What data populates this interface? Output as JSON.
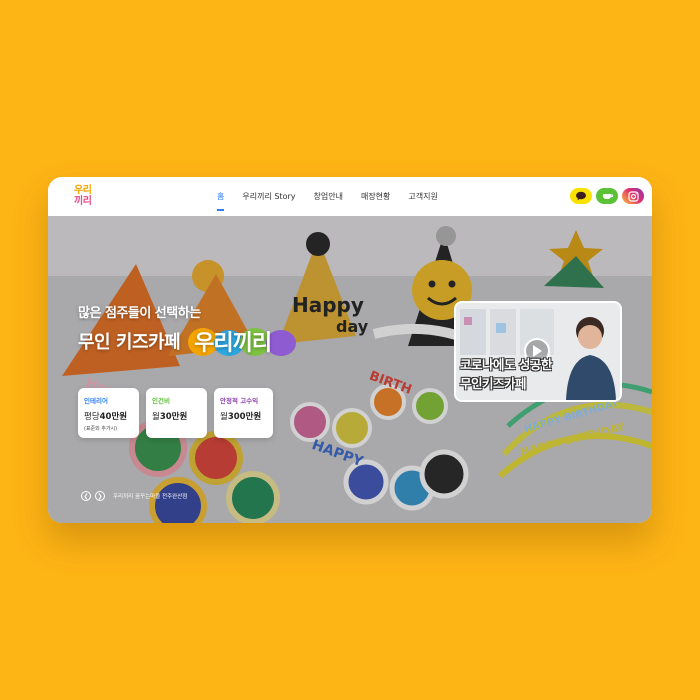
{
  "logo": {
    "line1": "우리",
    "line2": "끼리"
  },
  "nav": {
    "items": [
      {
        "label": "홈",
        "active": true
      },
      {
        "label": "우리끼리 Story",
        "active": false
      },
      {
        "label": "창업안내",
        "active": false
      },
      {
        "label": "매장현황",
        "active": false
      },
      {
        "label": "고객지원",
        "active": false
      }
    ]
  },
  "social": [
    {
      "icon": "kakao-talk-icon",
      "color": "#FAE100"
    },
    {
      "icon": "naver-blog-icon",
      "color": "#5BC236"
    },
    {
      "icon": "instagram-icon",
      "color": "#E1306C"
    }
  ],
  "hero": {
    "tagline": "많은 점주들이 선택하는",
    "headline": "무인 키즈카페",
    "brand": "우리끼리",
    "cards": [
      {
        "label": "인테리어",
        "label_color": "#2d7ff9",
        "prefix": "평당",
        "value": "40만원",
        "note": "(표준외 추가시)"
      },
      {
        "label": "인건비",
        "label_color": "#5BC236",
        "prefix": "월",
        "value": "30만원",
        "note": ""
      },
      {
        "label": "안정적 고수익",
        "label_color": "#8e44ad",
        "prefix": "월",
        "value": "300만원",
        "note": ""
      }
    ],
    "slide_caption": "우리끼리 꿈꾸는마을 전주완산점"
  },
  "video": {
    "line1": "코로나에도 성공한",
    "line2": "무인키즈카페"
  },
  "colors": {
    "background": "#FDB415",
    "accent": "#2d7ff9"
  }
}
